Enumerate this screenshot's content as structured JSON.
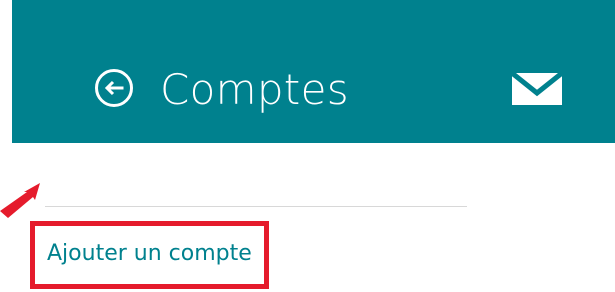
{
  "header": {
    "title": "Comptes",
    "back_icon": "back-arrow-circle-icon",
    "mail_icon": "mail-envelope-icon",
    "background": "#00818e"
  },
  "content": {
    "add_account_label": "Ajouter un compte",
    "link_color": "#00818e",
    "highlight_color": "#e51b2c",
    "annotation_icon": "red-arrow-icon"
  }
}
